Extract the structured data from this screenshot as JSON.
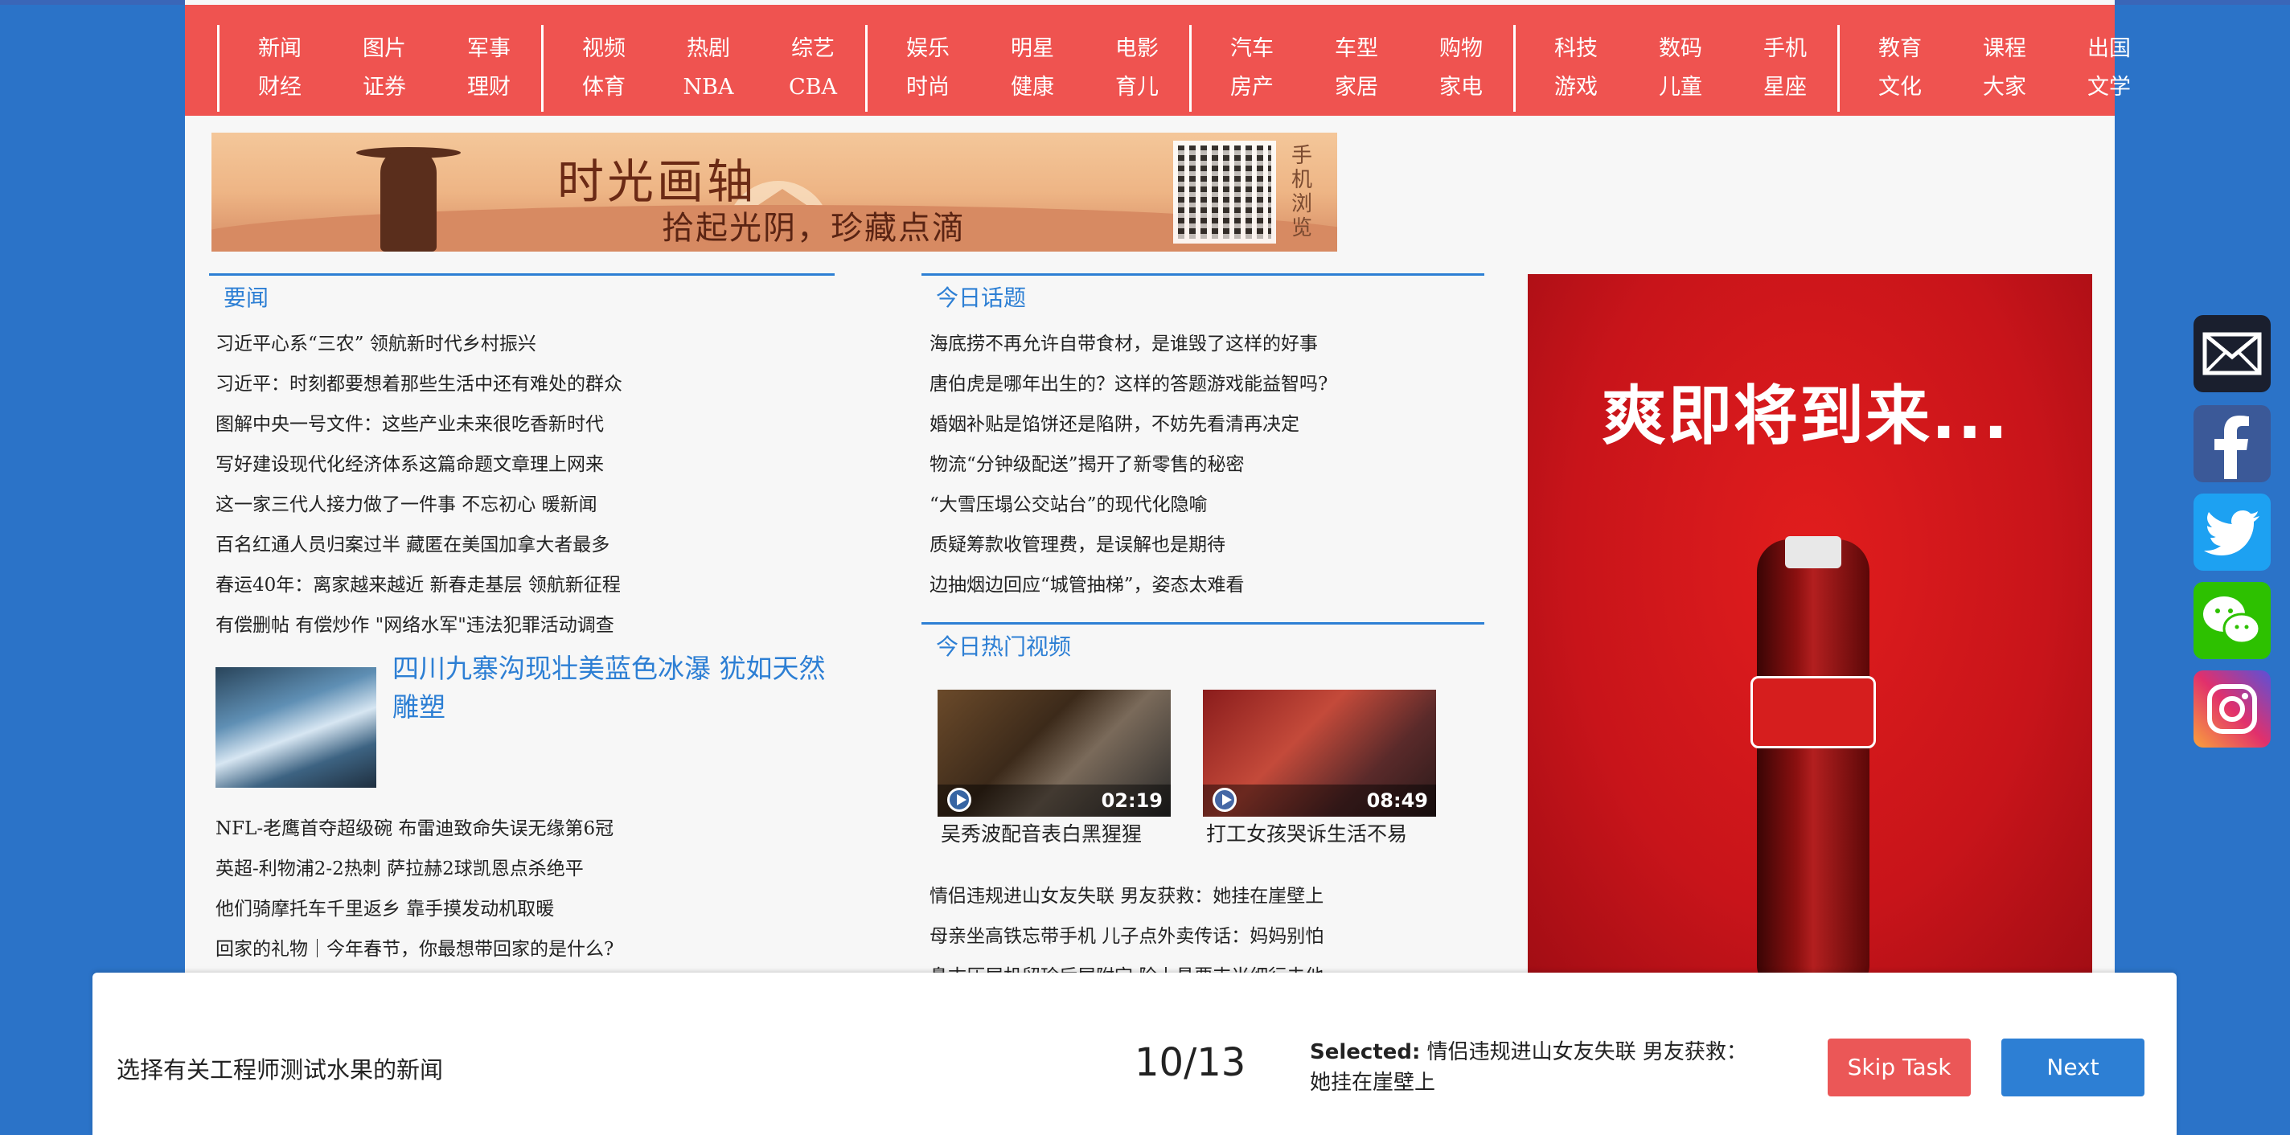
{
  "nav": {
    "groups": [
      [
        [
          "新闻",
          "财经"
        ],
        [
          "图片",
          "证券"
        ],
        [
          "军事",
          "理财"
        ]
      ],
      [
        [
          "视频",
          "体育"
        ],
        [
          "热剧",
          "NBA"
        ],
        [
          "综艺",
          "CBA"
        ]
      ],
      [
        [
          "娱乐",
          "时尚"
        ],
        [
          "明星",
          "健康"
        ],
        [
          "电影",
          "育儿"
        ]
      ],
      [
        [
          "汽车",
          "房产"
        ],
        [
          "车型",
          "家居"
        ],
        [
          "购物",
          "家电"
        ]
      ],
      [
        [
          "科技",
          "游戏"
        ],
        [
          "数码",
          "儿童"
        ],
        [
          "手机",
          "星座"
        ]
      ],
      [
        [
          "教育",
          "文化"
        ],
        [
          "课程",
          "大家"
        ],
        [
          "出国",
          "文学"
        ]
      ]
    ]
  },
  "banner": {
    "title": "时光画轴",
    "subtitle": "拾起光阴，珍藏点滴",
    "mobile": "手机浏览"
  },
  "news": {
    "heading": "要闻",
    "items": [
      "习近平心系“三农” 领航新时代乡村振兴",
      "习近平：时刻都要想着那些生活中还有难处的群众",
      "图解中央一号文件：这些产业未来很吃香新时代",
      "写好建设现代化经济体系这篇命题文章理上网来",
      "这一家三代人接力做了一件事 不忘初心 暖新闻",
      "百名红通人员归案过半 藏匿在美国加拿大者最多",
      "春运40年：离家越来越近 新春走基层 领航新征程",
      "有偿删帖 有偿炒作 \"网络水军\"违法犯罪活动调查"
    ],
    "feature_title": "四川九寨沟现壮美蓝色冰瀑 犹如天然雕塑",
    "more": [
      "NFL-老鹰首夺超级碗 布雷迪致命失误无缘第6冠",
      "英超-利物浦2-2热刺 萨拉赫2球凯恩点杀绝平",
      "他们骑摩托车千里返乡 靠手摸发动机取暖",
      "回家的礼物｜今年春节，你最想带回家的是什么?"
    ]
  },
  "topics": {
    "heading": "今日话题",
    "items": [
      "海底捞不再允许自带食材，是谁毁了这样的好事",
      "唐伯虎是哪年出生的？这样的答题游戏能益智吗?",
      "婚姻补贴是馅饼还是陷阱，不妨先看清再决定",
      "物流“分钟级配送”揭开了新零售的秘密",
      "“大雪压塌公交站台”的现代化隐喻",
      "质疑筹款收管理费，是误解也是期待",
      "边抽烟边回应“城管抽梯”，姿态太难看"
    ]
  },
  "videos": {
    "heading": "今日热门视频",
    "items": [
      {
        "duration": "02:19",
        "caption": "吴秀波配音表白黑猩猩"
      },
      {
        "duration": "08:49",
        "caption": "打工女孩哭诉生活不易"
      }
    ],
    "more": [
      "情侣违规进山女友失联 男友获救：她挂在崖壁上",
      "母亲坐高铁忘带手机 儿子点外卖传话：妈妈别怕",
      "鼻古压层机留珍后层附定 险上昌要支当细行去他"
    ]
  },
  "ad": {
    "slogan": "爽即将到来..."
  },
  "social": [
    "mail-icon",
    "facebook-icon",
    "twitter-icon",
    "wechat-icon",
    "instagram-icon"
  ],
  "task": {
    "instruction": "选择有关工程师测试水果的新闻",
    "progress": "10/13",
    "selected_label": "Selected:",
    "selected_value": "情侣违规进山女友失联 男友获救：她挂在崖壁上",
    "skip_label": "Skip Task",
    "next_label": "Next"
  },
  "colors": {
    "nav": "#ef5350",
    "accent": "#2d7fd4",
    "background": "#2b73c8",
    "skip": "#eb5757"
  }
}
